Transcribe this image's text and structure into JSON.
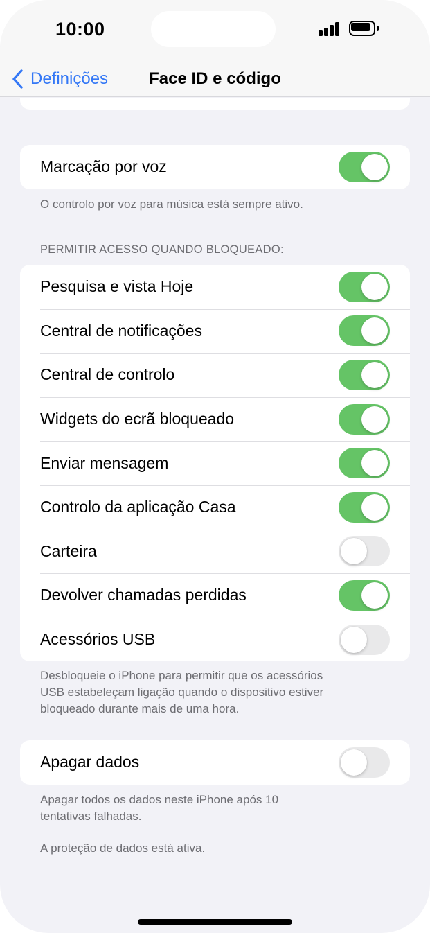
{
  "status": {
    "time": "10:00"
  },
  "nav": {
    "back_label": "Definições",
    "title": "Face ID e código"
  },
  "voice": {
    "label": "Marcação por voz",
    "on": true,
    "footnote": "O controlo por voz para música está sempre ativo."
  },
  "locked_access": {
    "header": "PERMITIR ACESSO QUANDO BLOQUEADO:",
    "items": [
      {
        "label": "Pesquisa e vista Hoje",
        "on": true
      },
      {
        "label": "Central de notificações",
        "on": true
      },
      {
        "label": "Central de controlo",
        "on": true
      },
      {
        "label": "Widgets do ecrã bloqueado",
        "on": true
      },
      {
        "label": "Enviar mensagem",
        "on": true
      },
      {
        "label": "Controlo da aplicação Casa",
        "on": true
      },
      {
        "label": "Carteira",
        "on": false
      },
      {
        "label": "Devolver chamadas perdidas",
        "on": true
      },
      {
        "label": "Acessórios USB",
        "on": false
      }
    ],
    "footnote_lines": [
      "Desbloqueie o iPhone para permitir que os acessórios",
      "USB estabeleçam ligação quando o dispositivo estiver",
      "bloqueado durante mais de uma hora."
    ]
  },
  "erase": {
    "label": "Apagar dados",
    "on": false,
    "footnote_lines": [
      "Apagar todos os dados neste iPhone após 10",
      "tentativas falhadas."
    ],
    "protection_note": "A proteção de dados está ativa."
  },
  "colors": {
    "accent": "#3478f6",
    "toggle_on": "#65c466",
    "toggle_off": "#e9e9ea"
  }
}
